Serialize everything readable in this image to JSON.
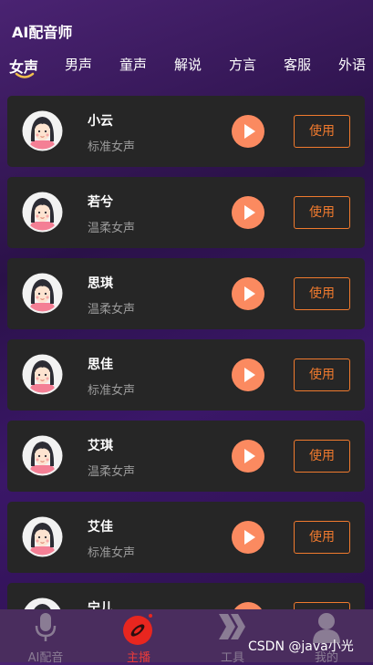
{
  "header": {
    "title": "AI配音师"
  },
  "tabs": [
    "女声",
    "男声",
    "童声",
    "解说",
    "方言",
    "客服",
    "外语"
  ],
  "voices": [
    {
      "name": "小云",
      "type": "标准女声"
    },
    {
      "name": "若兮",
      "type": "温柔女声"
    },
    {
      "name": "思琪",
      "type": "温柔女声"
    },
    {
      "name": "思佳",
      "type": "标准女声"
    },
    {
      "name": "艾琪",
      "type": "温柔女声"
    },
    {
      "name": "艾佳",
      "type": "标准女声"
    },
    {
      "name": "宁儿",
      "type": ""
    }
  ],
  "use_label": "使用",
  "nav": {
    "items": [
      {
        "label": "AI配音",
        "icon": "microphone-icon"
      },
      {
        "label": "主播",
        "icon": "anchor-icon"
      },
      {
        "label": "工具",
        "icon": "chevrons-icon"
      },
      {
        "label": "我的",
        "icon": "user-icon"
      }
    ]
  },
  "watermark": "CSDN @java小光",
  "colors": {
    "accent": "#f07a2e",
    "play": "#fb8a60",
    "active_nav": "#e83a3a"
  }
}
